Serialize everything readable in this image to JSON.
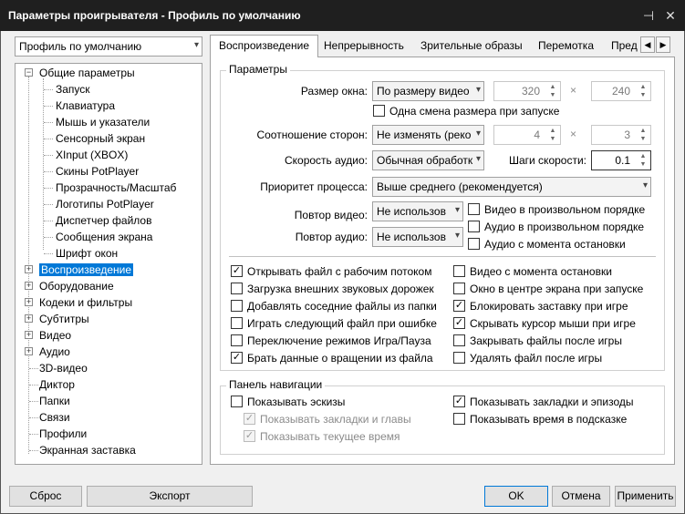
{
  "window": {
    "title": "Параметры проигрывателя - Профиль по умолчанию"
  },
  "profile_select": {
    "value": "Профиль по умолчанию"
  },
  "tree": {
    "general": "Общие параметры",
    "children": [
      "Запуск",
      "Клавиатура",
      "Мышь и указатели",
      "Сенсорный экран",
      "XInput (XBOX)",
      "Скины PotPlayer",
      "Прозрачность/Масштаб",
      "Логотипы PotPlayer",
      "Диспетчер файлов",
      "Сообщения экрана",
      "Шрифт окон"
    ],
    "top": [
      "Воспроизведение",
      "Оборудование",
      "Кодеки и фильтры",
      "Субтитры",
      "Видео",
      "Аудио",
      "3D-видео",
      "Диктор",
      "Папки",
      "Связи",
      "Профили",
      "Экранная заставка"
    ]
  },
  "tabs": [
    "Воспроизведение",
    "Непрерывность",
    "Зрительные образы",
    "Перемотка",
    "Пред"
  ],
  "params": {
    "group_title": "Параметры",
    "window_size_label": "Размер окна:",
    "window_size_value": "По размеру видео",
    "width": "320",
    "height": "240",
    "x_sign": "×",
    "resize_once": "Одна смена размера при запуске",
    "aspect_label": "Соотношение сторон:",
    "aspect_value": "Не изменять (реко",
    "aspect_w": "4",
    "aspect_h": "3",
    "audio_speed_label": "Скорость аудио:",
    "audio_speed_value": "Обычная обработк",
    "speed_step_label": "Шаги скорости:",
    "speed_step_value": "0.1",
    "priority_label": "Приоритет процесса:",
    "priority_value": "Выше среднего (рекомендуется)",
    "video_repeat_label": "Повтор видео:",
    "video_repeat_value": "Не использов",
    "audio_repeat_label": "Повтор аудио:",
    "audio_repeat_value": "Не использов",
    "video_random": "Видео в произвольном порядке",
    "audio_random": "Аудио в произвольном порядке",
    "audio_resume": "Аудио с момента остановки"
  },
  "options_left": [
    {
      "label": "Открывать файл с рабочим потоком",
      "checked": true
    },
    {
      "label": "Загрузка внешних звуковых дорожек",
      "checked": false
    },
    {
      "label": "Добавлять соседние файлы из папки",
      "checked": false
    },
    {
      "label": "Играть следующий файл при ошибке",
      "checked": false
    },
    {
      "label": "Переключение режимов Игра/Пауза",
      "checked": false
    },
    {
      "label": "Брать данные о вращении из файла",
      "checked": true
    }
  ],
  "options_right": [
    {
      "label": "Видео с момента остановки",
      "checked": false
    },
    {
      "label": "Окно в центре экрана при запуске",
      "checked": false
    },
    {
      "label": "Блокировать заставку при игре",
      "checked": true
    },
    {
      "label": "Скрывать курсор мыши при игре",
      "checked": true
    },
    {
      "label": "Закрывать файлы после игры",
      "checked": false
    },
    {
      "label": "Удалять файл после игры",
      "checked": false
    }
  ],
  "nav": {
    "group_title": "Панель навигации",
    "show_thumbs": "Показывать эскизы",
    "show_bookmarks_chapters": "Показывать закладки и главы",
    "show_current_time": "Показывать текущее время",
    "show_bookmarks_episodes": "Показывать закладки и эпизоды",
    "show_time_tooltip": "Показывать время в подсказке"
  },
  "buttons": {
    "reset": "Сброс",
    "export": "Экспорт",
    "ok": "OK",
    "cancel": "Отмена",
    "apply": "Применить"
  },
  "check_glyph": "✓",
  "colors": {
    "title_bg": "#1f1f1f",
    "selection": "#0078d7"
  }
}
